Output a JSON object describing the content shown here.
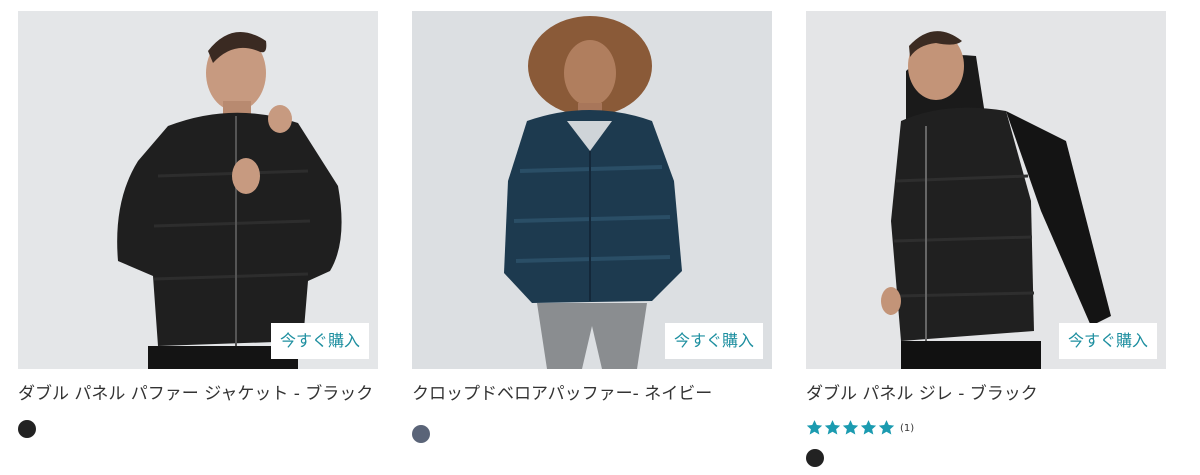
{
  "colors": {
    "button_text": "#1e8fa0",
    "star": "#1b9bb0"
  },
  "products": [
    {
      "buy_label": "今すぐ購入",
      "title": "ダブル パネル パファー ジャケット - ブラック",
      "swatch_color": "#222222"
    },
    {
      "buy_label": "今すぐ購入",
      "title": "クロップドベロアパッファー- ネイビー",
      "swatch_color": "#5a6478"
    },
    {
      "buy_label": "今すぐ購入",
      "title": "ダブル パネル ジレ - ブラック",
      "rating": 5,
      "review_count": "(1)",
      "swatch_color": "#222222"
    }
  ]
}
